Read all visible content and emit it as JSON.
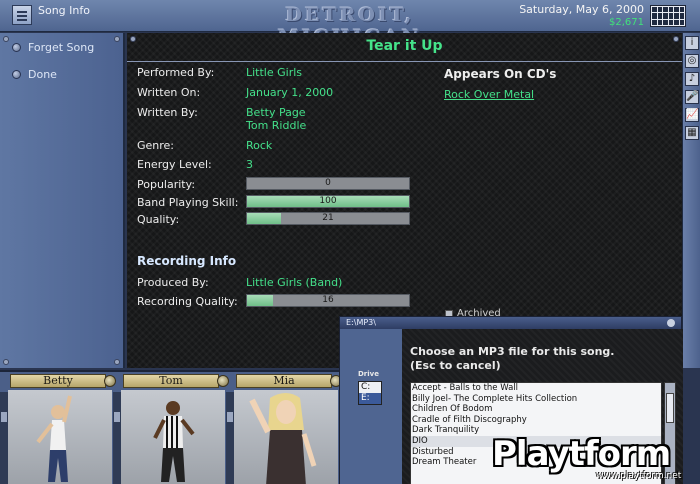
{
  "window": {
    "title": "Song Info",
    "city": "DETROIT, MICHIGAN",
    "date": "Saturday, May 6, 2000",
    "money": "$2,671"
  },
  "colors": {
    "accent_green": "#44e08a",
    "panel_bg": "#161718",
    "chrome_blue": "#4f6590"
  },
  "sidebar": {
    "items": [
      {
        "label": "Forget Song"
      },
      {
        "label": "Done"
      }
    ]
  },
  "song": {
    "title": "Tear it Up",
    "fields": {
      "performed_by": {
        "label": "Performed By:",
        "value": "Little Girls"
      },
      "written_on": {
        "label": "Written On:",
        "value": "January 1, 2000"
      },
      "written_by": {
        "label": "Written By:",
        "value1": "Betty Page",
        "value2": "Tom Riddle"
      },
      "genre": {
        "label": "Genre:",
        "value": "Rock"
      },
      "energy": {
        "label": "Energy Level:",
        "value": "3"
      },
      "popularity": {
        "label": "Popularity:",
        "value": "0"
      },
      "band_skill": {
        "label": "Band Playing Skill:",
        "value": "100"
      },
      "quality": {
        "label": "Quality:",
        "value": "21"
      }
    },
    "recording": {
      "heading": "Recording Info",
      "produced_by": {
        "label": "Produced By:",
        "value": "Little Girls (Band)"
      },
      "recording_quality": {
        "label": "Recording Quality:",
        "value": "16"
      }
    },
    "appears_on": {
      "heading": "Appears On CD's",
      "cds": [
        "Rock Over Metal"
      ]
    },
    "archived_label": "Archived"
  },
  "toolbar_icons": [
    "info-icon",
    "disc-icon",
    "music-note-icon",
    "microphone-icon",
    "chart-icon",
    "map-icon"
  ],
  "toolbar_glyphs": [
    "i",
    "◎",
    "♪",
    "🎤",
    "📈",
    "▦"
  ],
  "band": {
    "members": [
      {
        "name": "Betty"
      },
      {
        "name": "Tom"
      },
      {
        "name": "Mia"
      }
    ]
  },
  "dialog": {
    "title": "E:\\MP3\\",
    "message_line1": "Choose an MP3 file for this song.",
    "message_line2": "(Esc to cancel)",
    "drive_label": "Drive",
    "drives": [
      "C:",
      "E:"
    ],
    "selected_drive": "E:",
    "files": [
      "Accept - Balls to the Wall",
      "Billy Joel- The Complete Hits Collection",
      "Children Of Bodom",
      "Cradle of Filth Discography",
      "Dark Tranquility",
      "DIO",
      "Disturbed",
      "Dream Theater"
    ],
    "selected_file": "DIO"
  },
  "watermark": {
    "brand": "Playtform",
    "url": "www.playtform.net"
  }
}
